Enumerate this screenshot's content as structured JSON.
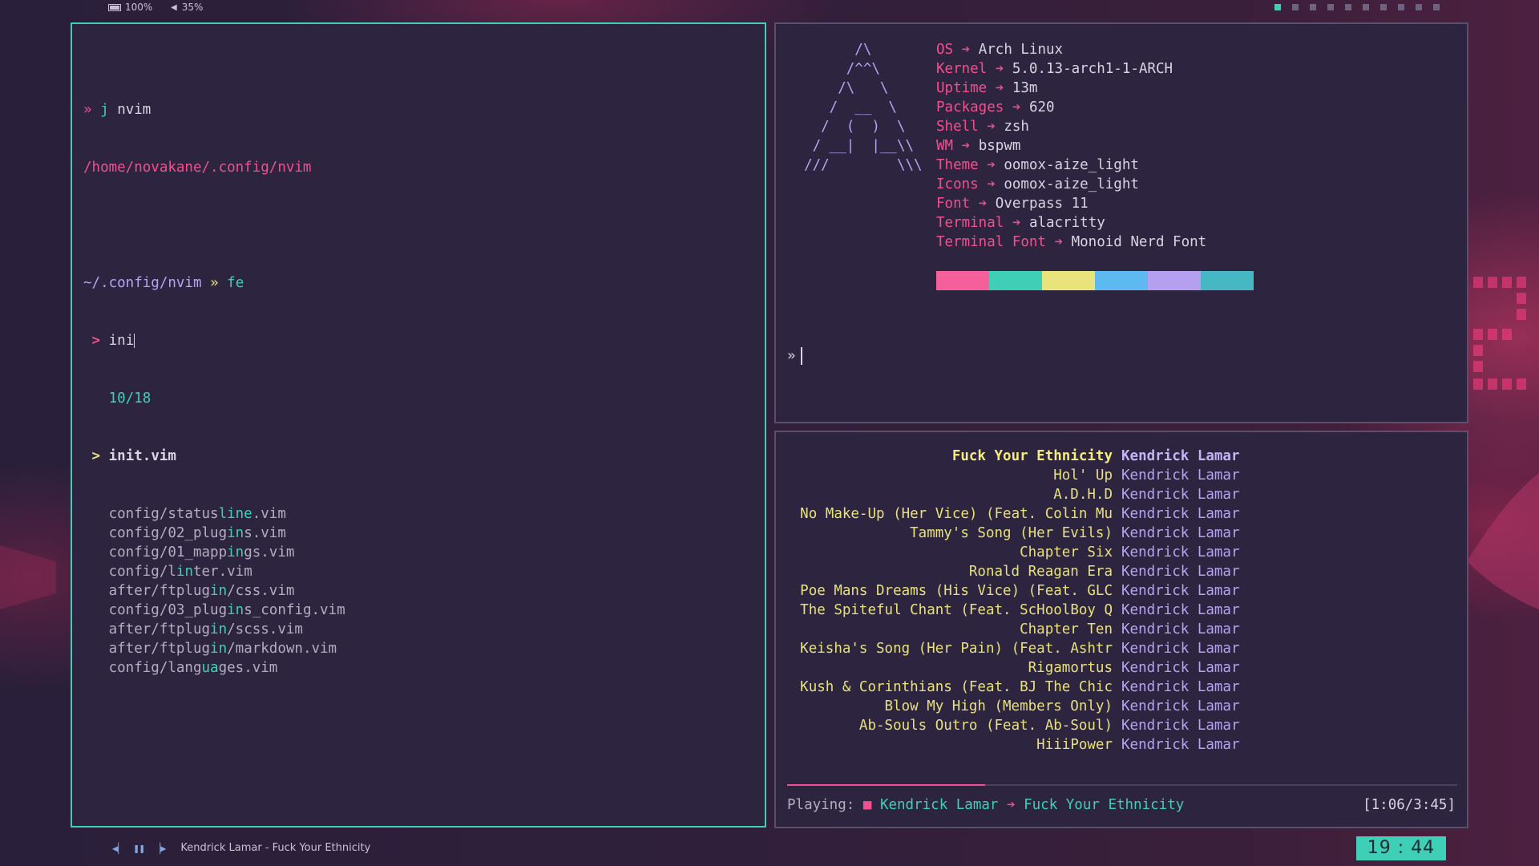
{
  "status_bar": {
    "battery": "100%",
    "volume": "35%",
    "workspaces": [
      {
        "active": true
      },
      {
        "active": false
      },
      {
        "active": false
      },
      {
        "active": false
      },
      {
        "active": false
      },
      {
        "active": false
      },
      {
        "active": false
      },
      {
        "active": false
      },
      {
        "active": false
      },
      {
        "active": false
      }
    ]
  },
  "left_terminal": {
    "cmd1_prompt": "»",
    "cmd1_cmd": "j",
    "cmd1_arg": "nvim",
    "cmd1_output": "/home/novakane/.config/nvim",
    "cmd2_path": "~/.config/nvim",
    "cmd2_prompt": "»",
    "cmd2_cmd": "fe",
    "fzf_marker": ">",
    "fzf_query": "ini",
    "fzf_count": "10/18",
    "selected_file": "init.vim",
    "files": [
      {
        "pre": "config/status",
        "match": "line",
        "post": ".vim"
      },
      {
        "pre": "config/02_plug",
        "match": "in",
        "post": "s.vim"
      },
      {
        "pre": "config/01_mapp",
        "match": "in",
        "post": "gs.vim"
      },
      {
        "pre": "config/l",
        "match": "in",
        "post": "ter.vim"
      },
      {
        "pre": "after/ftplug",
        "match": "in",
        "post": "/css.vim"
      },
      {
        "pre": "config/03_plug",
        "match": "in",
        "post": "s_config.vim"
      },
      {
        "pre": "after/ftplug",
        "match": "in",
        "post": "/scss.vim"
      },
      {
        "pre": "after/ftplug",
        "match": "in",
        "post": "/markdown.vim"
      },
      {
        "pre": "config/lang",
        "match": "ua",
        "post": "ges.vim"
      }
    ]
  },
  "sysinfo": {
    "ascii": [
      "        /\\",
      "       /^^\\",
      "      /\\   \\",
      "     /  __  \\",
      "    /  (  )  \\",
      "   / __|  |__\\\\",
      "  ///        \\\\\\"
    ],
    "items": [
      {
        "key": "OS",
        "value": "Arch Linux"
      },
      {
        "key": "Kernel",
        "value": "5.0.13-arch1-1-ARCH"
      },
      {
        "key": "Uptime",
        "value": "13m"
      },
      {
        "key": "Packages",
        "value": "620"
      },
      {
        "key": "Shell",
        "value": "zsh"
      },
      {
        "key": "WM",
        "value": "bspwm"
      },
      {
        "key": "Theme",
        "value": "oomox-aize_light"
      },
      {
        "key": "Icons",
        "value": "oomox-aize_light"
      },
      {
        "key": "Font",
        "value": "Overpass 11"
      },
      {
        "key": "Terminal",
        "value": "alacritty"
      },
      {
        "key": "Terminal Font",
        "value": "Monoid Nerd Font"
      }
    ],
    "arrow": "➔",
    "palette": [
      "#f5609a",
      "#3ecfb6",
      "#e8e37a",
      "#5db9ef",
      "#b4a0ef",
      "#48b7c4"
    ],
    "prompt": "»"
  },
  "music": {
    "playlist": [
      {
        "title": "Fuck Your Ethnicity",
        "artist": "Kendrick Lamar",
        "current": true
      },
      {
        "title": "Hol' Up",
        "artist": "Kendrick Lamar"
      },
      {
        "title": "A.D.H.D",
        "artist": "Kendrick Lamar"
      },
      {
        "title": "No Make-Up (Her Vice) (Feat. Colin Mu",
        "artist": "Kendrick Lamar"
      },
      {
        "title": "Tammy's Song (Her Evils)",
        "artist": "Kendrick Lamar"
      },
      {
        "title": "Chapter Six",
        "artist": "Kendrick Lamar"
      },
      {
        "title": "Ronald Reagan Era",
        "artist": "Kendrick Lamar"
      },
      {
        "title": "Poe Mans Dreams (His Vice) (Feat. GLC",
        "artist": "Kendrick Lamar"
      },
      {
        "title": "The Spiteful Chant (Feat. ScHoolBoy Q",
        "artist": "Kendrick Lamar"
      },
      {
        "title": "Chapter Ten",
        "artist": "Kendrick Lamar"
      },
      {
        "title": "Keisha's Song (Her Pain) (Feat. Ashtr",
        "artist": "Kendrick Lamar"
      },
      {
        "title": "Rigamortus",
        "artist": "Kendrick Lamar"
      },
      {
        "title": "Kush & Corinthians (Feat. BJ The Chic",
        "artist": "Kendrick Lamar"
      },
      {
        "title": "Blow My High (Members Only)",
        "artist": "Kendrick Lamar"
      },
      {
        "title": "Ab-Souls Outro (Feat. Ab-Soul)",
        "artist": "Kendrick Lamar"
      },
      {
        "title": "HiiiPower",
        "artist": "Kendrick Lamar"
      }
    ],
    "progress_fraction": 0.295,
    "playing_label": "Playing:",
    "status_icon": "■",
    "now_artist": "Kendrick Lamar",
    "now_arrow": "➔",
    "now_title": "Fuck Your Ethnicity",
    "time": "[1:06/3:45]"
  },
  "bottom_bar": {
    "now_playing": "Kendrick Lamar - Fuck Your Ethnicity",
    "clock": "19 : 44"
  }
}
